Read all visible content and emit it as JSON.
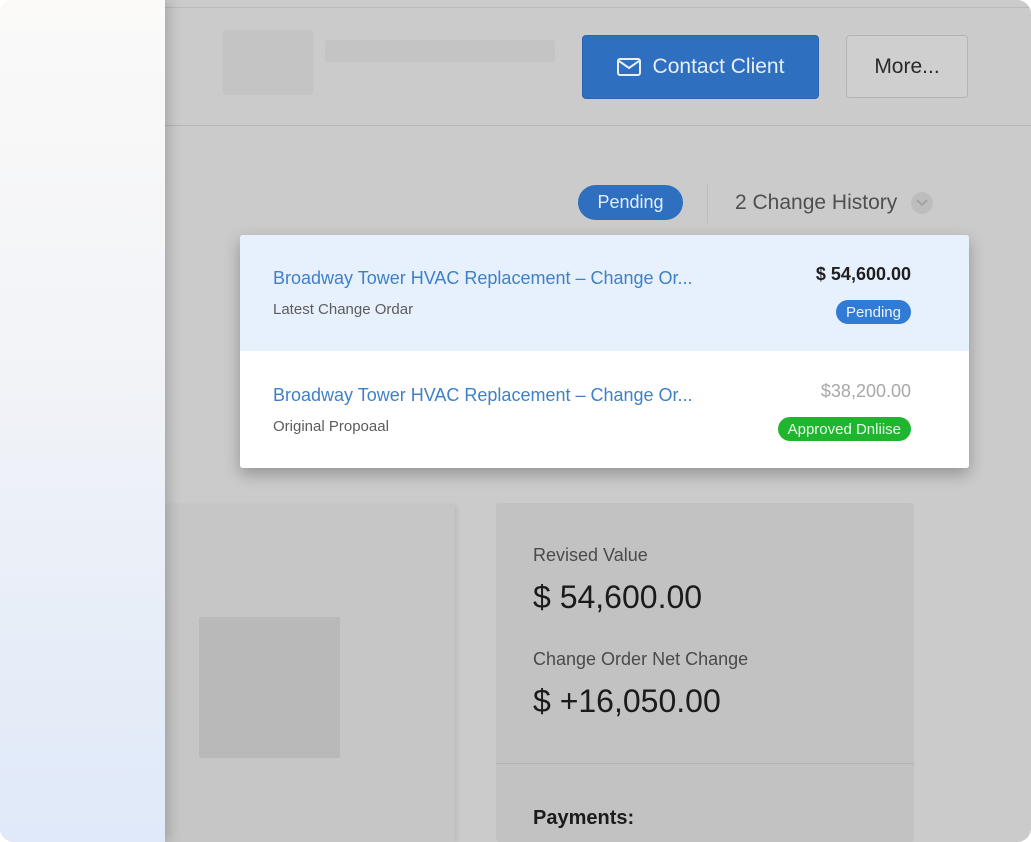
{
  "header": {
    "contact_label": "Contact Client",
    "more_label": "More..."
  },
  "status": {
    "pill": "Pending",
    "history_label": "2 Change History"
  },
  "change_orders": [
    {
      "title": "Broadway Tower HVAC Replacement – Change Or...",
      "subtitle": "Latest Change Ordar",
      "amount": "$ 54,600.00",
      "badge": "Pending"
    },
    {
      "title": "Broadway Tower HVAC Replacement – Change Or...",
      "subtitle": "Original Propoaal",
      "amount": "$38,200.00",
      "badge": "Approved Dnliise"
    }
  ],
  "summary": {
    "revised_label": "Revised Value",
    "revised_value": "$ 54,600.00",
    "net_label": "Change Order Net Change",
    "net_value": "$ +16,050.00",
    "payments_label": "Payments:"
  },
  "colors": {
    "accent": "#2f6fbf",
    "link": "#3f80c6",
    "success": "#1fb52e"
  },
  "icons": {
    "contact": "envelope-icon",
    "history_toggle": "chevron-down-icon"
  }
}
